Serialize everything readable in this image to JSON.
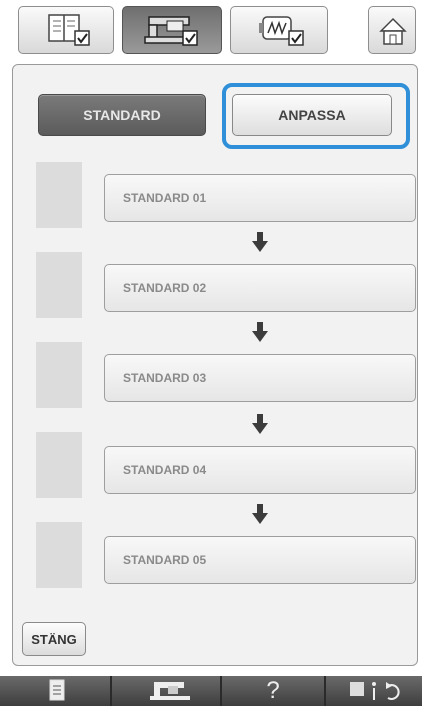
{
  "top_tabs": [
    {
      "icon": "book-checkbox-icon",
      "active": false
    },
    {
      "icon": "machine-checkbox-icon",
      "active": true
    },
    {
      "icon": "embroidery-checkbox-icon",
      "active": false
    },
    {
      "icon": "home-icon",
      "active": false
    }
  ],
  "mode": {
    "standard_label": "STANDARD",
    "custom_label": "ANPASSA",
    "selected": "ANPASSA",
    "selection_color": "#2f8fd8"
  },
  "sequence": [
    {
      "label": "STANDARD 01"
    },
    {
      "label": "STANDARD 02"
    },
    {
      "label": "STANDARD 03"
    },
    {
      "label": "STANDARD 04"
    },
    {
      "label": "STANDARD 05"
    }
  ],
  "close_label": "STÄNG",
  "bottom_bar": {
    "help_label": "?",
    "icons": [
      "page-icon",
      "machine-icon",
      "help-icon",
      "needle-info-icon"
    ]
  }
}
